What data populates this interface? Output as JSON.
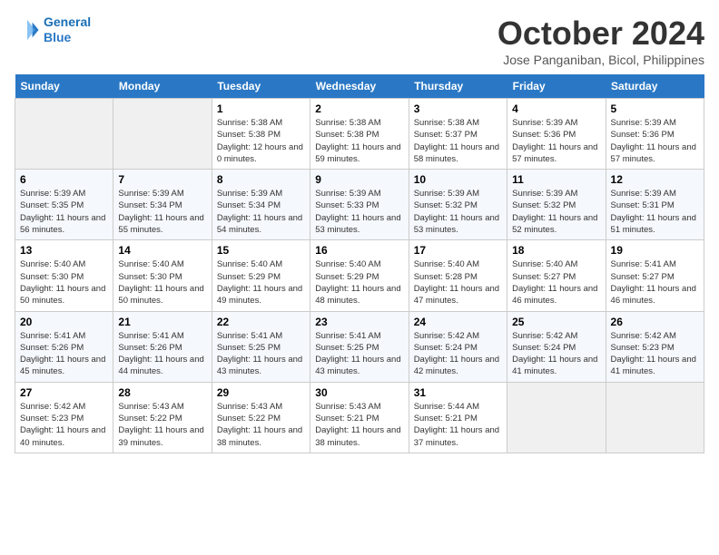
{
  "header": {
    "logo_line1": "General",
    "logo_line2": "Blue",
    "month_title": "October 2024",
    "location": "Jose Panganiban, Bicol, Philippines"
  },
  "days_of_week": [
    "Sunday",
    "Monday",
    "Tuesday",
    "Wednesday",
    "Thursday",
    "Friday",
    "Saturday"
  ],
  "weeks": [
    [
      {
        "day": "",
        "info": ""
      },
      {
        "day": "",
        "info": ""
      },
      {
        "day": "1",
        "info": "Sunrise: 5:38 AM\nSunset: 5:38 PM\nDaylight: 12 hours and 0 minutes."
      },
      {
        "day": "2",
        "info": "Sunrise: 5:38 AM\nSunset: 5:38 PM\nDaylight: 11 hours and 59 minutes."
      },
      {
        "day": "3",
        "info": "Sunrise: 5:38 AM\nSunset: 5:37 PM\nDaylight: 11 hours and 58 minutes."
      },
      {
        "day": "4",
        "info": "Sunrise: 5:39 AM\nSunset: 5:36 PM\nDaylight: 11 hours and 57 minutes."
      },
      {
        "day": "5",
        "info": "Sunrise: 5:39 AM\nSunset: 5:36 PM\nDaylight: 11 hours and 57 minutes."
      }
    ],
    [
      {
        "day": "6",
        "info": "Sunrise: 5:39 AM\nSunset: 5:35 PM\nDaylight: 11 hours and 56 minutes."
      },
      {
        "day": "7",
        "info": "Sunrise: 5:39 AM\nSunset: 5:34 PM\nDaylight: 11 hours and 55 minutes."
      },
      {
        "day": "8",
        "info": "Sunrise: 5:39 AM\nSunset: 5:34 PM\nDaylight: 11 hours and 54 minutes."
      },
      {
        "day": "9",
        "info": "Sunrise: 5:39 AM\nSunset: 5:33 PM\nDaylight: 11 hours and 53 minutes."
      },
      {
        "day": "10",
        "info": "Sunrise: 5:39 AM\nSunset: 5:32 PM\nDaylight: 11 hours and 53 minutes."
      },
      {
        "day": "11",
        "info": "Sunrise: 5:39 AM\nSunset: 5:32 PM\nDaylight: 11 hours and 52 minutes."
      },
      {
        "day": "12",
        "info": "Sunrise: 5:39 AM\nSunset: 5:31 PM\nDaylight: 11 hours and 51 minutes."
      }
    ],
    [
      {
        "day": "13",
        "info": "Sunrise: 5:40 AM\nSunset: 5:30 PM\nDaylight: 11 hours and 50 minutes."
      },
      {
        "day": "14",
        "info": "Sunrise: 5:40 AM\nSunset: 5:30 PM\nDaylight: 11 hours and 50 minutes."
      },
      {
        "day": "15",
        "info": "Sunrise: 5:40 AM\nSunset: 5:29 PM\nDaylight: 11 hours and 49 minutes."
      },
      {
        "day": "16",
        "info": "Sunrise: 5:40 AM\nSunset: 5:29 PM\nDaylight: 11 hours and 48 minutes."
      },
      {
        "day": "17",
        "info": "Sunrise: 5:40 AM\nSunset: 5:28 PM\nDaylight: 11 hours and 47 minutes."
      },
      {
        "day": "18",
        "info": "Sunrise: 5:40 AM\nSunset: 5:27 PM\nDaylight: 11 hours and 46 minutes."
      },
      {
        "day": "19",
        "info": "Sunrise: 5:41 AM\nSunset: 5:27 PM\nDaylight: 11 hours and 46 minutes."
      }
    ],
    [
      {
        "day": "20",
        "info": "Sunrise: 5:41 AM\nSunset: 5:26 PM\nDaylight: 11 hours and 45 minutes."
      },
      {
        "day": "21",
        "info": "Sunrise: 5:41 AM\nSunset: 5:26 PM\nDaylight: 11 hours and 44 minutes."
      },
      {
        "day": "22",
        "info": "Sunrise: 5:41 AM\nSunset: 5:25 PM\nDaylight: 11 hours and 43 minutes."
      },
      {
        "day": "23",
        "info": "Sunrise: 5:41 AM\nSunset: 5:25 PM\nDaylight: 11 hours and 43 minutes."
      },
      {
        "day": "24",
        "info": "Sunrise: 5:42 AM\nSunset: 5:24 PM\nDaylight: 11 hours and 42 minutes."
      },
      {
        "day": "25",
        "info": "Sunrise: 5:42 AM\nSunset: 5:24 PM\nDaylight: 11 hours and 41 minutes."
      },
      {
        "day": "26",
        "info": "Sunrise: 5:42 AM\nSunset: 5:23 PM\nDaylight: 11 hours and 41 minutes."
      }
    ],
    [
      {
        "day": "27",
        "info": "Sunrise: 5:42 AM\nSunset: 5:23 PM\nDaylight: 11 hours and 40 minutes."
      },
      {
        "day": "28",
        "info": "Sunrise: 5:43 AM\nSunset: 5:22 PM\nDaylight: 11 hours and 39 minutes."
      },
      {
        "day": "29",
        "info": "Sunrise: 5:43 AM\nSunset: 5:22 PM\nDaylight: 11 hours and 38 minutes."
      },
      {
        "day": "30",
        "info": "Sunrise: 5:43 AM\nSunset: 5:21 PM\nDaylight: 11 hours and 38 minutes."
      },
      {
        "day": "31",
        "info": "Sunrise: 5:44 AM\nSunset: 5:21 PM\nDaylight: 11 hours and 37 minutes."
      },
      {
        "day": "",
        "info": ""
      },
      {
        "day": "",
        "info": ""
      }
    ]
  ]
}
